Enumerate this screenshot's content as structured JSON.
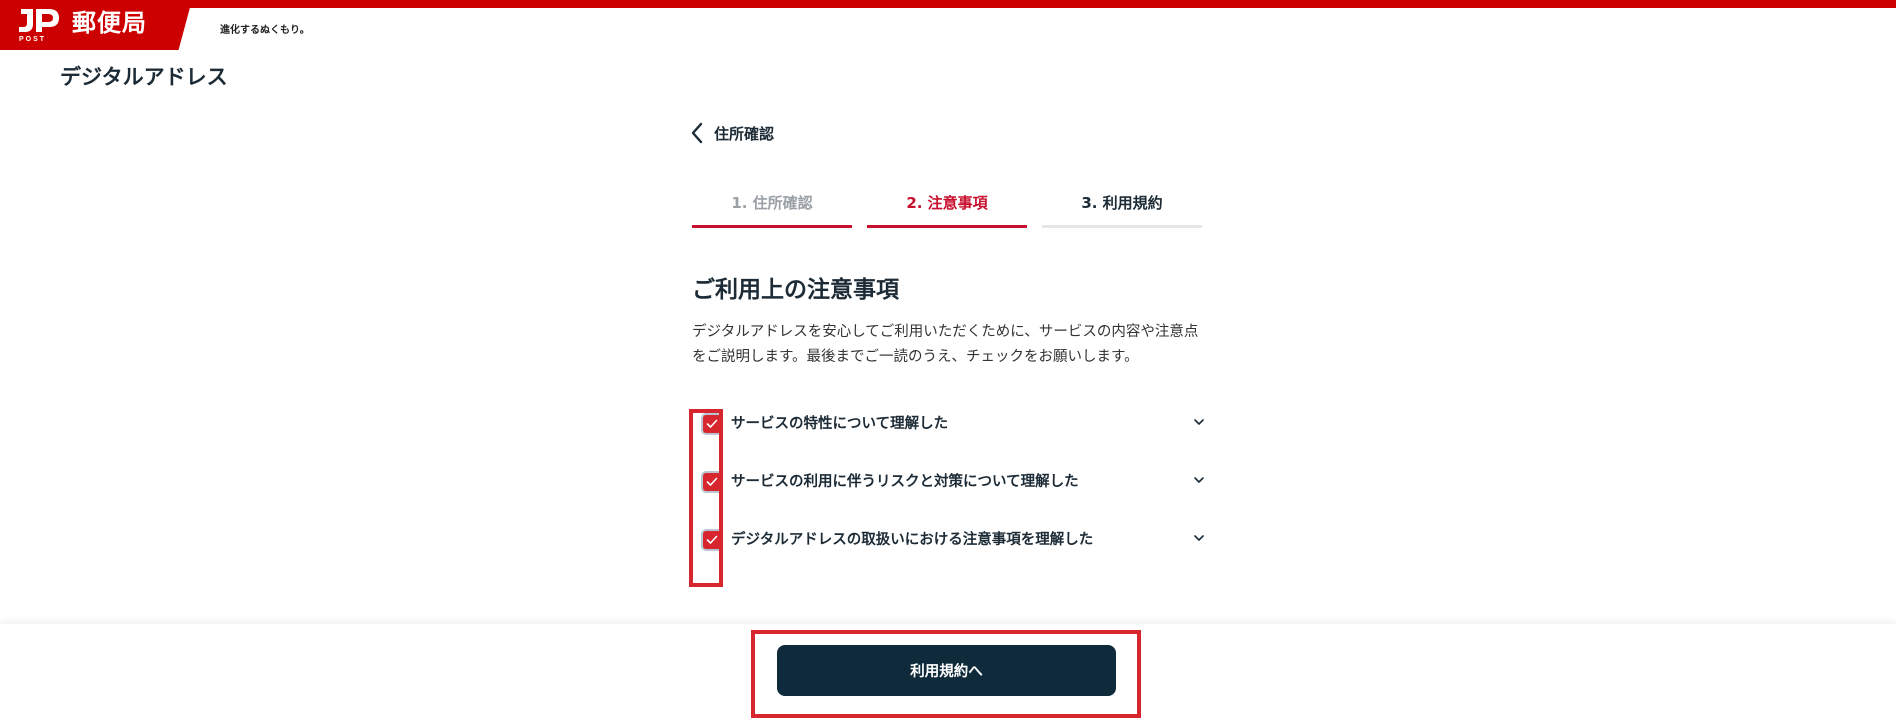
{
  "header": {
    "logo_text": "JP POST",
    "brand": "郵便局",
    "tagline": "進化するぬくもり。"
  },
  "page": {
    "title": "デジタルアドレス"
  },
  "nav": {
    "back_label": "住所確認"
  },
  "stepper": {
    "steps": [
      {
        "label": "1. 住所確認",
        "state": "done"
      },
      {
        "label": "2. 注意事項",
        "state": "current"
      },
      {
        "label": "3. 利用規約",
        "state": "todo"
      }
    ]
  },
  "section": {
    "heading": "ご利用上の注意事項",
    "description": "デジタルアドレスを安心してご利用いただくために、サービスの内容や注意点をご説明します。最後までご一読のうえ、チェックをお願いします。"
  },
  "checklist": {
    "items": [
      {
        "label": "サービスの特性について理解した",
        "checked": true
      },
      {
        "label": "サービスの利用に伴うリスクと対策について理解した",
        "checked": true
      },
      {
        "label": "デジタルアドレスの取扱いにおける注意事項を理解した",
        "checked": true
      }
    ]
  },
  "footer": {
    "next_button_label": "利用規約へ"
  },
  "colors": {
    "brand_red": "#cc0000",
    "accent_red": "#c8102e",
    "navy": "#0f2a3a",
    "checkbox_red": "#d8262f"
  },
  "icons": {
    "back": "chevron-left-icon",
    "expand": "chevron-down-icon",
    "check": "check-icon"
  }
}
